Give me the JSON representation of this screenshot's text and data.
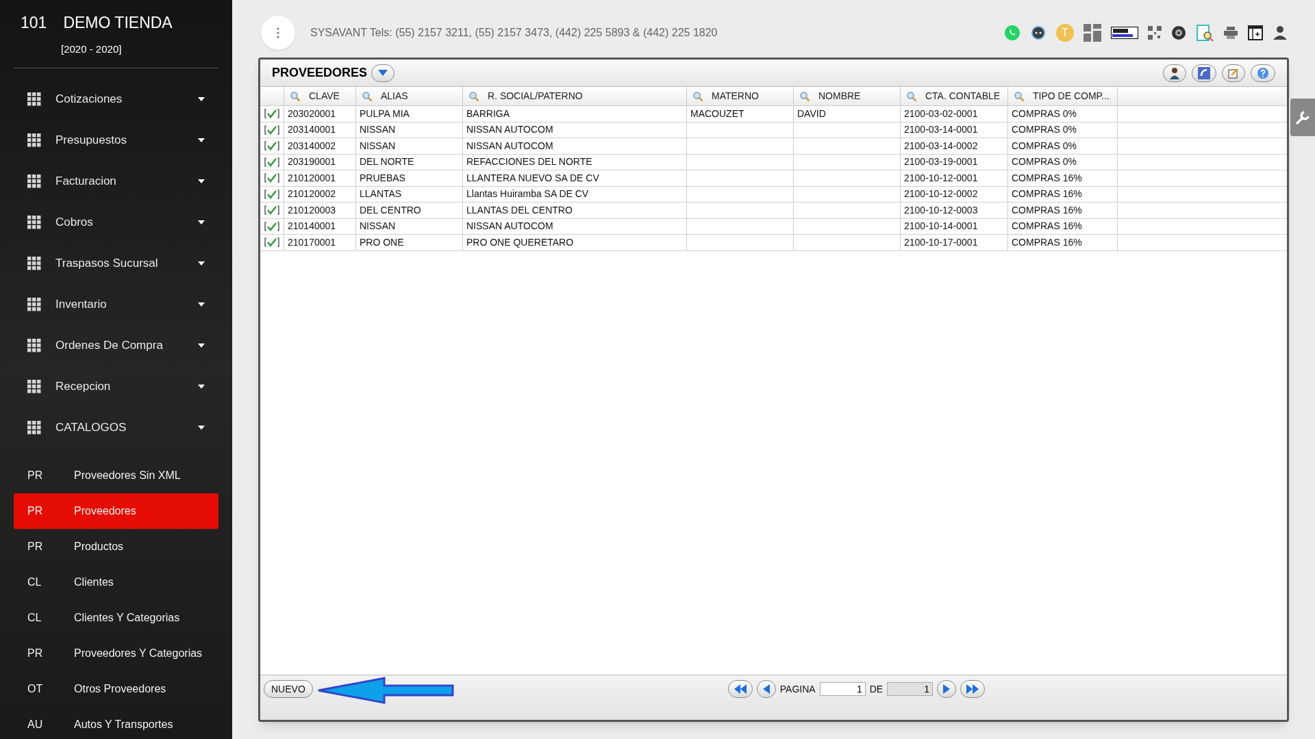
{
  "brand": {
    "number": "101",
    "name": "DEMO TIENDA",
    "period": "[2020 - 2020]"
  },
  "menu": [
    {
      "label": "Cotizaciones",
      "expanded": false
    },
    {
      "label": "Presupuestos",
      "expanded": false
    },
    {
      "label": "Facturacion",
      "expanded": false
    },
    {
      "label": "Cobros",
      "expanded": false
    },
    {
      "label": "Traspasos Sucursal",
      "expanded": false
    },
    {
      "label": "Inventario",
      "expanded": false
    },
    {
      "label": "Ordenes De Compra",
      "expanded": false
    },
    {
      "label": "Recepcion",
      "expanded": false
    },
    {
      "label": "CATALOGOS",
      "expanded": false
    }
  ],
  "catalog_items": [
    {
      "abbr": "PR",
      "label": "Proveedores Sin XML",
      "selected": false
    },
    {
      "abbr": "PR",
      "label": "Proveedores",
      "selected": true
    },
    {
      "abbr": "PR",
      "label": "Productos",
      "selected": false
    },
    {
      "abbr": "CL",
      "label": "Clientes",
      "selected": false
    },
    {
      "abbr": "CL",
      "label": "Clientes Y Categorias",
      "selected": false
    },
    {
      "abbr": "PR",
      "label": "Proveedores Y Categorias",
      "selected": false
    },
    {
      "abbr": "OT",
      "label": "Otros Proveedores",
      "selected": false
    },
    {
      "abbr": "AU",
      "label": "Autos Y Transportes",
      "selected": false
    }
  ],
  "top_bar": {
    "contact": "SYSAVANT Tels: (55) 2157 3211, (55) 2157 3473, (442) 225 5893 & (442) 225 1820",
    "avatar_letter": "T"
  },
  "panel": {
    "title": "PROVEEDORES",
    "columns": [
      "CLAVE",
      "ALIAS",
      "R. SOCIAL/PATERNO",
      "MATERNO",
      "NOMBRE",
      "CTA. CONTABLE",
      "TIPO DE COMP..."
    ],
    "rows": [
      {
        "checked": true,
        "cells": [
          "203020001",
          "PULPA MIA",
          "BARRIGA",
          "MACOUZET",
          "DAVID",
          "2100-03-02-0001",
          "COMPRAS 0%"
        ]
      },
      {
        "checked": true,
        "cells": [
          "203140001",
          "NISSAN",
          "NISSAN AUTOCOM",
          "",
          "",
          "2100-03-14-0001",
          "COMPRAS 0%"
        ]
      },
      {
        "checked": true,
        "cells": [
          "203140002",
          "NISSAN",
          "NISSAN AUTOCOM",
          "",
          "",
          "2100-03-14-0002",
          "COMPRAS 0%"
        ]
      },
      {
        "checked": true,
        "cells": [
          "203190001",
          "DEL NORTE",
          "REFACCIONES DEL NORTE",
          "",
          "",
          "2100-03-19-0001",
          "COMPRAS 0%"
        ]
      },
      {
        "checked": true,
        "cells": [
          "210120001",
          "PRUEBAS",
          "LLANTERA NUEVO SA DE CV",
          "",
          "",
          "2100-10-12-0001",
          "COMPRAS 16%"
        ]
      },
      {
        "checked": true,
        "cells": [
          "210120002",
          "LLANTAS",
          "Llantas Huiramba SA DE CV",
          "",
          "",
          "2100-10-12-0002",
          "COMPRAS 16%"
        ]
      },
      {
        "checked": true,
        "cells": [
          "210120003",
          "DEL CENTRO",
          "LLANTAS DEL CENTRO",
          "",
          "",
          "2100-10-12-0003",
          "COMPRAS 16%"
        ]
      },
      {
        "checked": true,
        "cells": [
          "210140001",
          "NISSAN",
          "NISSAN AUTOCOM",
          "",
          "",
          "2100-10-14-0001",
          "COMPRAS 16%"
        ]
      },
      {
        "checked": true,
        "cells": [
          "210170001",
          "PRO ONE",
          "PRO ONE QUERETARO",
          "",
          "",
          "2100-10-17-0001",
          "COMPRAS 16%"
        ]
      }
    ],
    "new_button": "NUEVO",
    "pager": {
      "page_label": "PAGINA",
      "page": "1",
      "of_label": "DE",
      "total": "1"
    }
  }
}
